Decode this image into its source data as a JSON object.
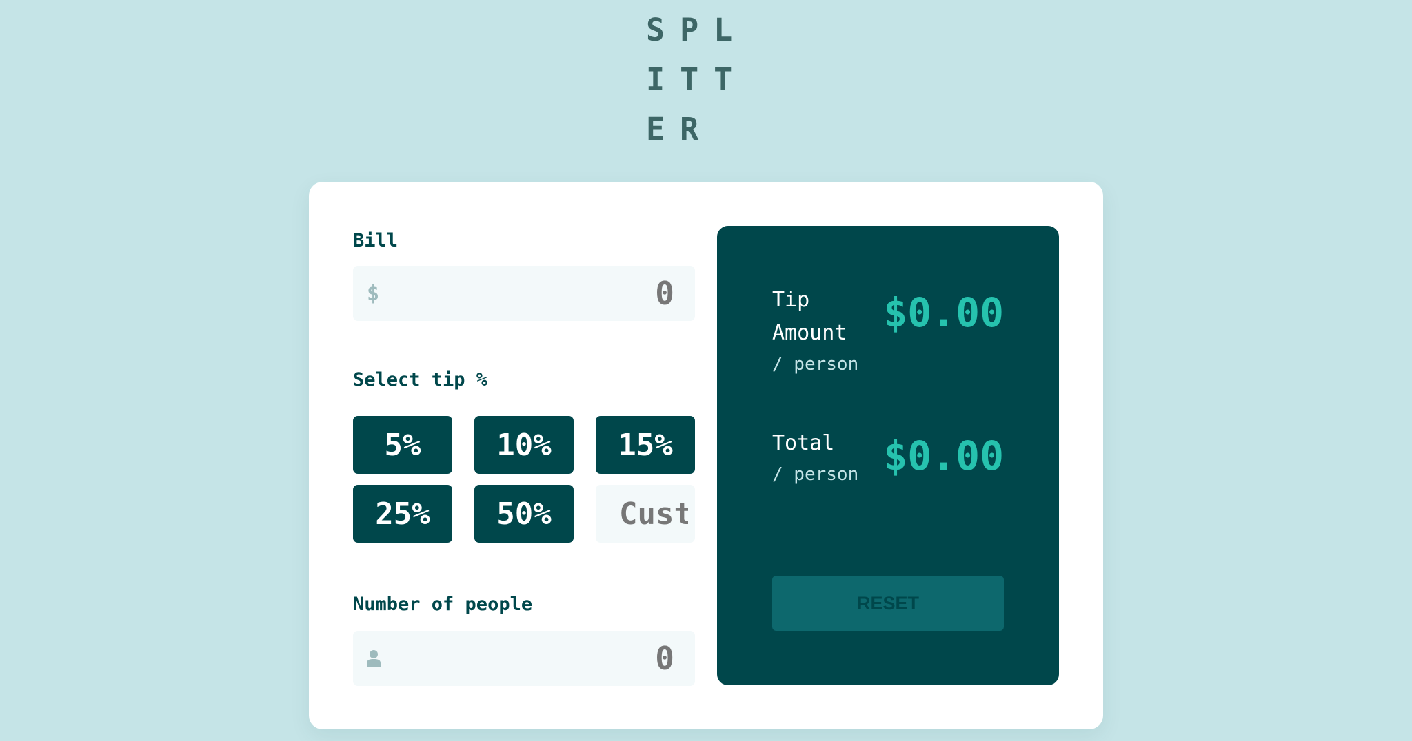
{
  "app": {
    "logo": "SPLITTER"
  },
  "bill": {
    "label": "Bill",
    "currency_symbol": "$",
    "value": "0"
  },
  "tip": {
    "label": "Select tip %",
    "options": [
      "5%",
      "10%",
      "15%",
      "25%",
      "50%"
    ],
    "custom_placeholder": "Custom"
  },
  "people": {
    "label": "Number of people",
    "icon": "person-icon",
    "value": "0"
  },
  "results": {
    "tip_amount_label_line1": "Tip",
    "tip_amount_label_line2": "Amount",
    "tip_amount_sub": "/ person",
    "tip_amount_value": "$0.00",
    "total_label": "Total",
    "total_sub": "/ person",
    "total_value": "$0.00",
    "reset_label": "RESET"
  },
  "colors": {
    "background": "#c5e4e7",
    "dark_cyan": "#00474b",
    "strong_cyan": "#26c2ae",
    "input_bg": "#f3f9fa",
    "reset_disabled": "#0d686d"
  }
}
